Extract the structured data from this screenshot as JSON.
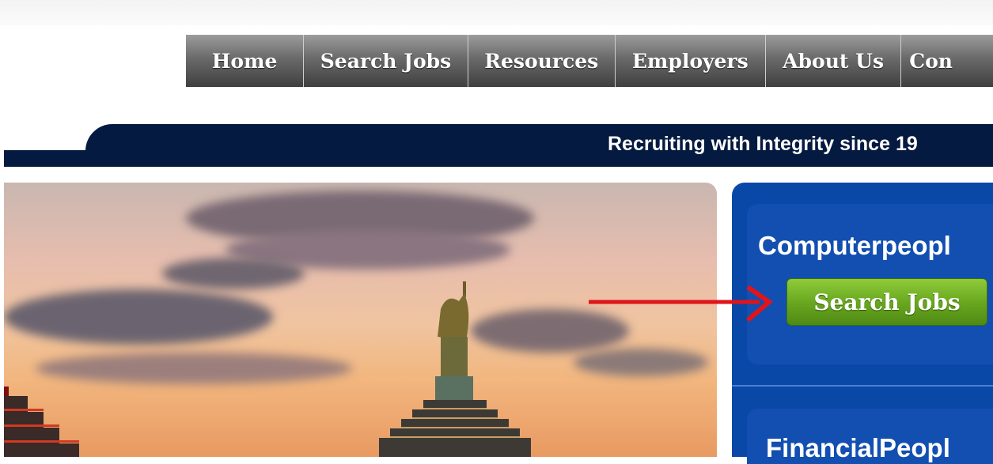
{
  "nav": {
    "items": [
      {
        "label": "Home"
      },
      {
        "label": "Search Jobs"
      },
      {
        "label": "Resources"
      },
      {
        "label": "Employers"
      },
      {
        "label": "About Us"
      },
      {
        "label": "Con"
      }
    ]
  },
  "banner": {
    "tagline": "Recruiting with Integrity since 19"
  },
  "panel": {
    "company1": "Computerpeopl",
    "search_button": "Search Jobs",
    "company2": "FinancialPeopl"
  },
  "colors": {
    "banner": "#051a40",
    "panel": "#0a48a8",
    "button_green": "#6aa820",
    "arrow_red": "#e0141a"
  },
  "icons": {
    "annotation_arrow": "red-arrow-icon",
    "hero": "statue-of-liberty-sunset-image"
  }
}
